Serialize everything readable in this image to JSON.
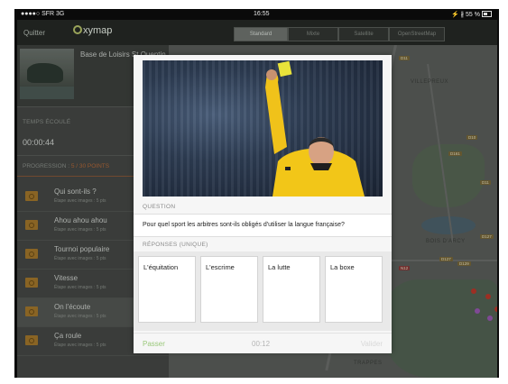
{
  "status_bar": {
    "carrier": "●●●●○ SFR  3G",
    "time": "16:55",
    "right": "⚡ ∦ 55 %"
  },
  "nav": {
    "quit_label": "Quitter",
    "logo_text": "xymap",
    "map_modes": [
      "Standard",
      "Mixte",
      "Satellite",
      "OpenStreetMap"
    ],
    "active_mode": "Standard"
  },
  "sidebar": {
    "place_name": "Base de Loisirs St Quentin",
    "listening_time_label": "TEMPS ÉCOULÉ",
    "elapsed_time": "00:00:44",
    "progression_label": "PROGRESSION : ",
    "progression_value": "5 / 30 POINTS",
    "steps": [
      {
        "title": "Qui sont-ils ?",
        "subtitle": "Étape avec images : 5 pts"
      },
      {
        "title": "Ahou ahou ahou",
        "subtitle": "Étape avec images : 5 pts"
      },
      {
        "title": "Tournoi populaire",
        "subtitle": "Étape avec images : 5 pts"
      },
      {
        "title": "Vitesse",
        "subtitle": "Étape avec images : 5 pts"
      },
      {
        "title": "On l'écoute",
        "subtitle": "Étape avec images : 5 pts"
      },
      {
        "title": "Ça roule",
        "subtitle": "Étape avec images : 5 pts"
      }
    ],
    "active_step_index": 4
  },
  "map": {
    "labels": [
      "VILLEPREUX",
      "BOIS D'ARCY",
      "TRAPPES"
    ],
    "road_badges": [
      "D11",
      "D161",
      "D10",
      "D11",
      "D127",
      "D127",
      "N12",
      "D129"
    ]
  },
  "quiz": {
    "image_description_icon": "referee-photo",
    "question_label": "QUESTION",
    "question_text": "Pour quel sport les arbitres sont-ils obligés d'utiliser la langue française?",
    "answers_label": "RÉPONSES (UNIQUE)",
    "answers": [
      "L'équitation",
      "L'escrime",
      "La lutte",
      "La boxe"
    ],
    "skip_label": "Passer",
    "countdown": "00:12",
    "validate_label": "Valider"
  },
  "colors": {
    "accent_green": "#9ac87a",
    "progress_orange": "#b86b3a",
    "step_icon": "#a87b2c"
  }
}
